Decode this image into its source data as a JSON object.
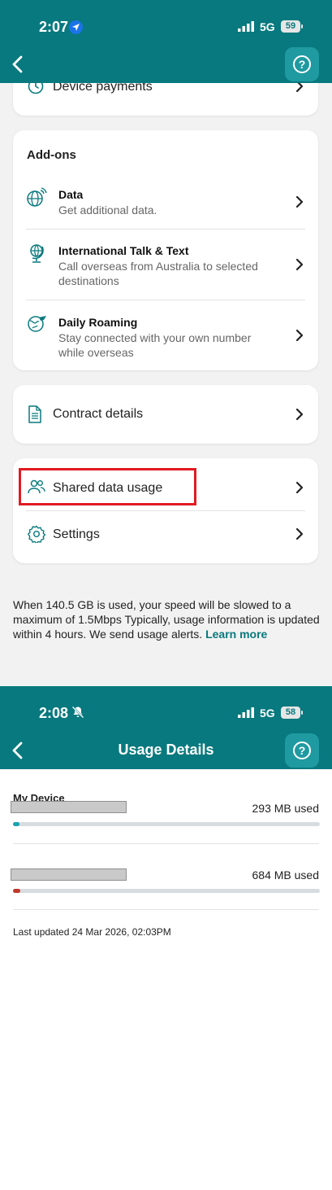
{
  "screen1": {
    "status": {
      "time": "2:07",
      "network": "5G",
      "battery": "59"
    },
    "device_payments_label": "Device payments",
    "addons": {
      "heading": "Add-ons",
      "items": [
        {
          "title": "Data",
          "subtitle": "Get additional data.",
          "icon": "globe-signal-icon"
        },
        {
          "title": "International Talk & Text",
          "subtitle": "Call overseas from Australia to selected destinations",
          "icon": "globe-stand-icon"
        },
        {
          "title": "Daily Roaming",
          "subtitle": "Stay connected with your own number while overseas",
          "icon": "globe-plane-icon"
        }
      ]
    },
    "contract_details_label": "Contract details",
    "shared_data_label": "Shared data usage",
    "settings_label": "Settings",
    "note_text": "When 140.5 GB is used, your speed will be slowed to a maximum of 1.5Mbps Typically, usage information is updated within 4 hours. We send usage alerts. ",
    "note_link": "Learn more"
  },
  "screen2": {
    "status": {
      "time": "2:08",
      "network": "5G",
      "battery": "58"
    },
    "title": "Usage Details",
    "section_title": "My Device",
    "lines": [
      {
        "used": "293 MB used",
        "progress_fraction": 0.02,
        "color": "#1aa3b0"
      },
      {
        "used": "684 MB used",
        "progress_fraction": 0.025,
        "color": "#c0392b"
      }
    ],
    "last_updated": "Last updated 24 Mar 2026, 02:03PM"
  },
  "colors": {
    "brand_teal": "#08797e",
    "help_button": "#1f9aa1",
    "highlight": "#e11b22"
  }
}
